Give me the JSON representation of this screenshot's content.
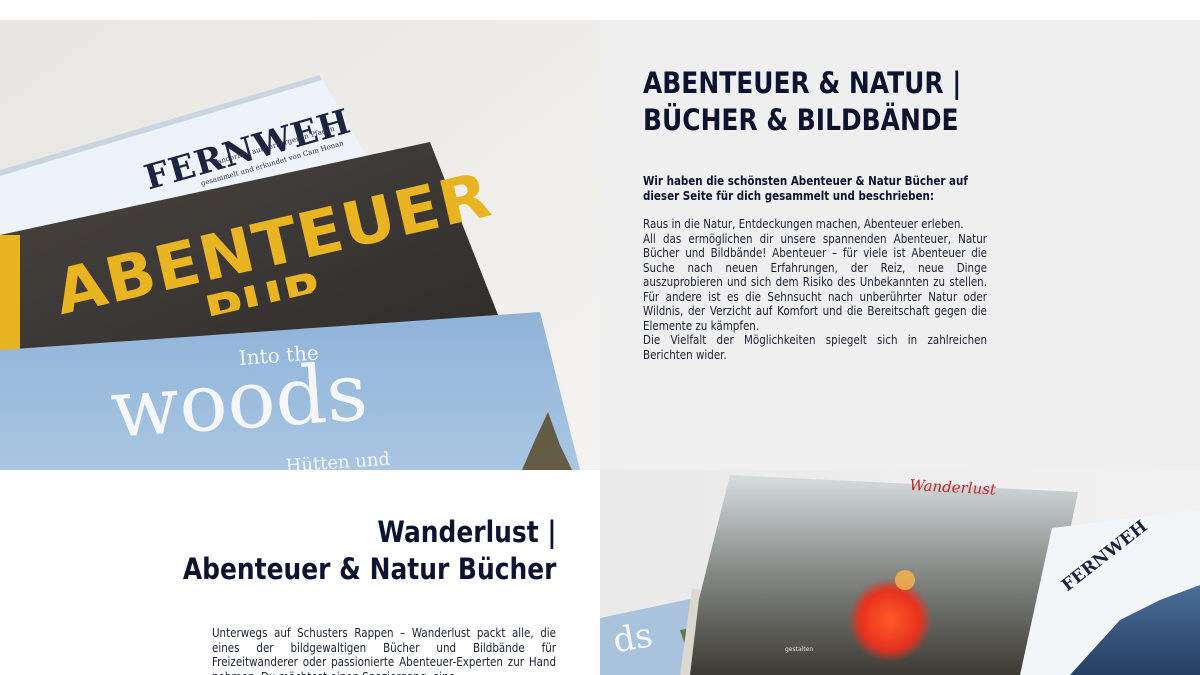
{
  "section1": {
    "heading_line1": "ABENTEUER & NATUR |",
    "heading_line2": "BÜCHER & BILDBÄNDE",
    "intro_bold": "Wir haben die schönsten Abenteuer & Natur Bücher auf dieser Seite für dich gesammelt und beschrieben:",
    "paragraphs": [
      "Raus in die Natur, Entdeckungen machen, Abenteuer erleben.",
      "All das ermöglichen dir unsere spannenden Abenteuer, Natur Bücher und Bildbände! Abenteuer – für viele ist Abenteuer die Suche nach neuen Erfahrungen, der Reiz, neue Dinge auszuprobieren und sich dem Risiko des Unbekannten zu stellen. Für andere ist es die Sehnsucht nach unberührter Natur oder Wildnis, der Verzicht auf Komfort und die Bereitschaft gegen die Elemente zu kämpfen.",
      "Die Vielfalt der Möglichkeiten spiegelt sich in zahlreichen Berichten wider."
    ],
    "image": {
      "book_fernweh_title": "FERNWEH",
      "book_fernweh_sub1": "Wanderlust auf verborgenen Pfaden",
      "book_fernweh_sub2": "gesammelt und erkundet von Cam Honan",
      "book_abenteuer_title": "ABENTEUER",
      "book_abenteuer_sub": "PUR",
      "book_woods_line1": "Into the",
      "book_woods_line2": "woods",
      "book_woods_line3": "Hütten und"
    }
  },
  "section2": {
    "heading_line1": "Wanderlust |",
    "heading_line2": "Abenteuer & Natur Bücher",
    "body": "Unterwegs auf Schusters Rappen – Wanderlust packt alle, die eines der bildgewaltigen Bücher und Bildbände für Freizeitwanderer oder passionierte Abenteuer-Experten zur Hand nehmen. Du möchtest einen Spaziergang, eine",
    "image": {
      "book_wanderlust_title": "Wanderlust",
      "book_fernweh_title": "FERNWEH",
      "book_woods_fragment": "ds",
      "publisher": "gestalten"
    }
  },
  "colors": {
    "heading": "#0e1430",
    "text": "#1a1f33",
    "panel_gray": "#efeff0",
    "accent_yellow": "#e8b422",
    "woods_blue": "#8fb3d8"
  }
}
